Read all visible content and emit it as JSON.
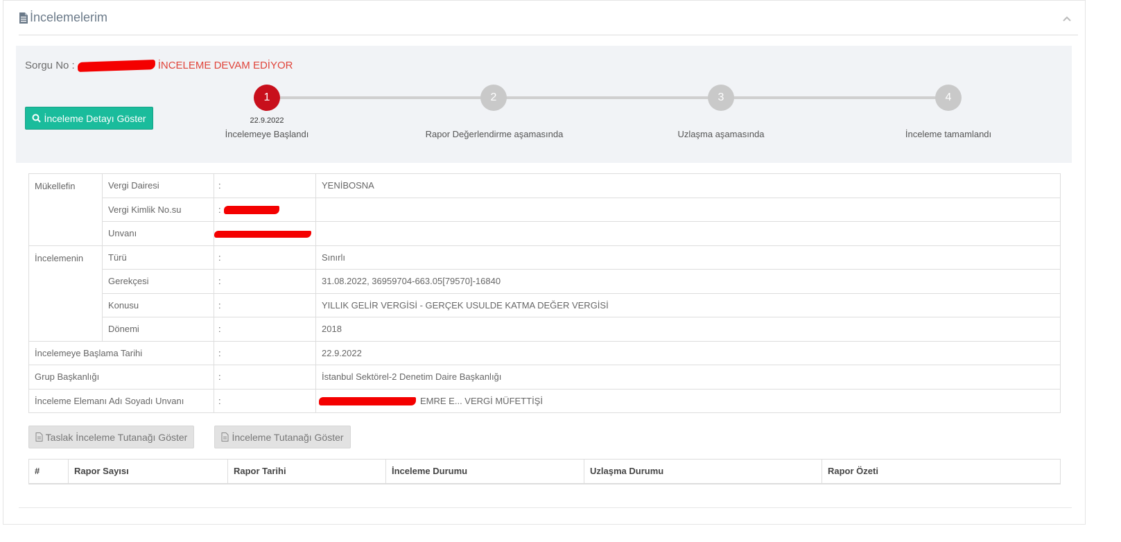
{
  "panel": {
    "title": "İncelemelerim",
    "icons": {
      "title": "document-icon",
      "collapse": "chevron-up-icon"
    }
  },
  "status": {
    "sorgu_label": "Sorgu No :",
    "state": "İNCELEME DEVAM EDİYOR",
    "detail_button": "İnceleme Detayı Göster",
    "accent_color": "#c80f1c",
    "button_color": "#1abc9c"
  },
  "steps": [
    {
      "number": "1",
      "date": "22.9.2022",
      "label": "İncelemeye Başlandı",
      "active": true
    },
    {
      "number": "2",
      "label": "Rapor Değerlendirme aşamasında",
      "active": false
    },
    {
      "number": "3",
      "label": "Uzlaşma aşamasında",
      "active": false
    },
    {
      "number": "4",
      "label": "İnceleme tamamlandı",
      "active": false
    }
  ],
  "info": {
    "mukellefin": "Mükellefin",
    "vergi_dairesi_label": "Vergi Dairesi",
    "vergi_dairesi_value": "YENİBOSNA",
    "vkn_label": "Vergi Kimlik No.su",
    "unvan_label": "Unvanı",
    "incelemenin": "İncelemenin",
    "turu_label": "Türü",
    "turu_value": "Sınırlı",
    "gerekcesi_label": "Gerekçesi",
    "gerekcesi_value": "31.08.2022, 36959704-663.05[79570]-16840",
    "konusu_label": "Konusu",
    "konusu_value": "YILLIK GELİR VERGİSİ - GERÇEK USULDE KATMA DEĞER VERGİSİ",
    "donemi_label": "Dönemi",
    "donemi_value": "2018",
    "baslama_label": "İncelemeye Başlama Tarihi",
    "baslama_value": "22.9.2022",
    "grup_label": "Grup Başkanlığı",
    "grup_value": "İstanbul Sektörel-2 Denetim Daire Başkanlığı",
    "eleman_label": "İnceleme Elemanı Adı Soyadı Unvanı",
    "eleman_value": "EMRE E...  VERGİ MÜFETTİŞİ",
    "sep": ":"
  },
  "buttons": {
    "taslak": "Taslak İnceleme Tutanağı Göster",
    "tutanak": "İnceleme Tutanağı Göster"
  },
  "report_table": {
    "headers": [
      "#",
      "Rapor Sayısı",
      "Rapor Tarihi",
      "İnceleme Durumu",
      "Uzlaşma Durumu",
      "Rapor Özeti"
    ]
  }
}
